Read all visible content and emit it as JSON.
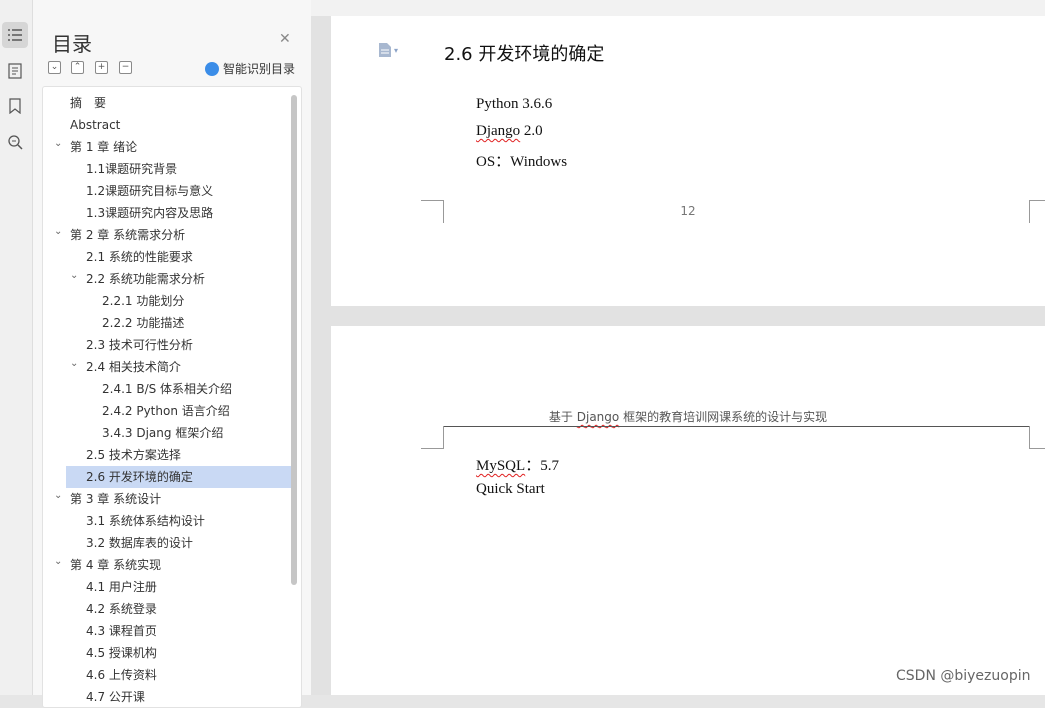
{
  "toc": {
    "title": "目录",
    "smart_label": "智能识别目录",
    "items": [
      {
        "label": "摘　要",
        "level": 0
      },
      {
        "label": "Abstract",
        "level": 0
      },
      {
        "label": "第 1 章  绪论",
        "level": 0,
        "expanded": true
      },
      {
        "label": "1.1课题研究背景",
        "level": 1
      },
      {
        "label": "1.2课题研究目标与意义",
        "level": 1
      },
      {
        "label": "1.3课题研究内容及思路",
        "level": 1
      },
      {
        "label": "第 2 章  系统需求分析",
        "level": 0,
        "expanded": true
      },
      {
        "label": "2.1 系统的性能要求",
        "level": 1
      },
      {
        "label": "2.2 系统功能需求分析",
        "level": 1,
        "expanded": true
      },
      {
        "label": "2.2.1 功能划分",
        "level": 2
      },
      {
        "label": "2.2.2 功能描述",
        "level": 2
      },
      {
        "label": "2.3 技术可行性分析",
        "level": 1
      },
      {
        "label": "2.4 相关技术简介",
        "level": 1,
        "expanded": true
      },
      {
        "label": "2.4.1 B/S 体系相关介绍",
        "level": 2
      },
      {
        "label": "2.4.2 Python 语言介绍",
        "level": 2
      },
      {
        "label": "3.4.3 Djang 框架介绍",
        "level": 2
      },
      {
        "label": "2.5 技术方案选择",
        "level": 1
      },
      {
        "label": "2.6 开发环境的确定",
        "level": 1,
        "selected": true
      },
      {
        "label": "第 3 章  系统设计",
        "level": 0,
        "expanded": true
      },
      {
        "label": "3.1 系统体系结构设计",
        "level": 1
      },
      {
        "label": "3.2 数据库表的设计",
        "level": 1
      },
      {
        "label": "第 4 章  系统实现",
        "level": 0,
        "expanded": true
      },
      {
        "label": "4.1 用户注册",
        "level": 1
      },
      {
        "label": "4.2 系统登录",
        "level": 1
      },
      {
        "label": "4.3 课程首页",
        "level": 1
      },
      {
        "label": "4.5 授课机构",
        "level": 1
      },
      {
        "label": "4.6 上传资料",
        "level": 1
      },
      {
        "label": "4.7 公开课",
        "level": 1
      }
    ]
  },
  "page1": {
    "heading": "2.6 开发环境的确定",
    "line1": "Python 3.6.6",
    "line2_word": "Django",
    "line2_rest": " 2.0",
    "line3": "OS：Windows",
    "page_number": "12"
  },
  "page2": {
    "header_prefix": "基于 ",
    "header_word": "Django",
    "header_rest": " 框架的教育培训网课系统的设计与实现",
    "line1_word": "MySQL",
    "line1_rest": "：5.7",
    "line2": "Quick Start"
  },
  "watermark": "CSDN @biyezuopin",
  "icons": [
    "toc-icon",
    "page-icon",
    "bookmark-icon",
    "search-icon",
    "close-icon",
    "collapse-all-icon",
    "expand-all-icon",
    "add-icon",
    "remove-icon",
    "ai-icon",
    "doc-type-icon"
  ]
}
